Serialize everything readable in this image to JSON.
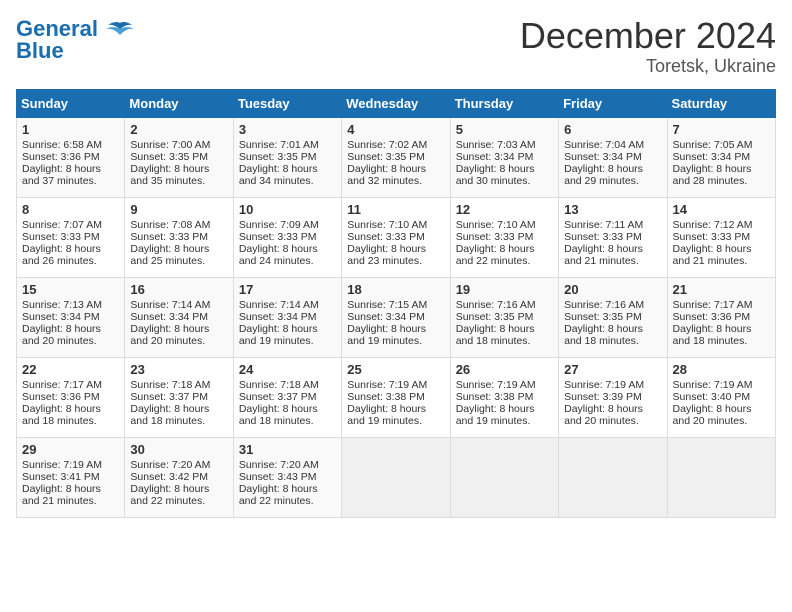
{
  "logo": {
    "text_general": "General",
    "text_blue": "Blue"
  },
  "title": "December 2024",
  "subtitle": "Toretsk, Ukraine",
  "days_header": [
    "Sunday",
    "Monday",
    "Tuesday",
    "Wednesday",
    "Thursday",
    "Friday",
    "Saturday"
  ],
  "weeks": [
    [
      {
        "day": "1",
        "sunrise": "Sunrise: 6:58 AM",
        "sunset": "Sunset: 3:36 PM",
        "daylight": "Daylight: 8 hours and 37 minutes."
      },
      {
        "day": "2",
        "sunrise": "Sunrise: 7:00 AM",
        "sunset": "Sunset: 3:35 PM",
        "daylight": "Daylight: 8 hours and 35 minutes."
      },
      {
        "day": "3",
        "sunrise": "Sunrise: 7:01 AM",
        "sunset": "Sunset: 3:35 PM",
        "daylight": "Daylight: 8 hours and 34 minutes."
      },
      {
        "day": "4",
        "sunrise": "Sunrise: 7:02 AM",
        "sunset": "Sunset: 3:35 PM",
        "daylight": "Daylight: 8 hours and 32 minutes."
      },
      {
        "day": "5",
        "sunrise": "Sunrise: 7:03 AM",
        "sunset": "Sunset: 3:34 PM",
        "daylight": "Daylight: 8 hours and 30 minutes."
      },
      {
        "day": "6",
        "sunrise": "Sunrise: 7:04 AM",
        "sunset": "Sunset: 3:34 PM",
        "daylight": "Daylight: 8 hours and 29 minutes."
      },
      {
        "day": "7",
        "sunrise": "Sunrise: 7:05 AM",
        "sunset": "Sunset: 3:34 PM",
        "daylight": "Daylight: 8 hours and 28 minutes."
      }
    ],
    [
      {
        "day": "8",
        "sunrise": "Sunrise: 7:07 AM",
        "sunset": "Sunset: 3:33 PM",
        "daylight": "Daylight: 8 hours and 26 minutes."
      },
      {
        "day": "9",
        "sunrise": "Sunrise: 7:08 AM",
        "sunset": "Sunset: 3:33 PM",
        "daylight": "Daylight: 8 hours and 25 minutes."
      },
      {
        "day": "10",
        "sunrise": "Sunrise: 7:09 AM",
        "sunset": "Sunset: 3:33 PM",
        "daylight": "Daylight: 8 hours and 24 minutes."
      },
      {
        "day": "11",
        "sunrise": "Sunrise: 7:10 AM",
        "sunset": "Sunset: 3:33 PM",
        "daylight": "Daylight: 8 hours and 23 minutes."
      },
      {
        "day": "12",
        "sunrise": "Sunrise: 7:10 AM",
        "sunset": "Sunset: 3:33 PM",
        "daylight": "Daylight: 8 hours and 22 minutes."
      },
      {
        "day": "13",
        "sunrise": "Sunrise: 7:11 AM",
        "sunset": "Sunset: 3:33 PM",
        "daylight": "Daylight: 8 hours and 21 minutes."
      },
      {
        "day": "14",
        "sunrise": "Sunrise: 7:12 AM",
        "sunset": "Sunset: 3:33 PM",
        "daylight": "Daylight: 8 hours and 21 minutes."
      }
    ],
    [
      {
        "day": "15",
        "sunrise": "Sunrise: 7:13 AM",
        "sunset": "Sunset: 3:34 PM",
        "daylight": "Daylight: 8 hours and 20 minutes."
      },
      {
        "day": "16",
        "sunrise": "Sunrise: 7:14 AM",
        "sunset": "Sunset: 3:34 PM",
        "daylight": "Daylight: 8 hours and 20 minutes."
      },
      {
        "day": "17",
        "sunrise": "Sunrise: 7:14 AM",
        "sunset": "Sunset: 3:34 PM",
        "daylight": "Daylight: 8 hours and 19 minutes."
      },
      {
        "day": "18",
        "sunrise": "Sunrise: 7:15 AM",
        "sunset": "Sunset: 3:34 PM",
        "daylight": "Daylight: 8 hours and 19 minutes."
      },
      {
        "day": "19",
        "sunrise": "Sunrise: 7:16 AM",
        "sunset": "Sunset: 3:35 PM",
        "daylight": "Daylight: 8 hours and 18 minutes."
      },
      {
        "day": "20",
        "sunrise": "Sunrise: 7:16 AM",
        "sunset": "Sunset: 3:35 PM",
        "daylight": "Daylight: 8 hours and 18 minutes."
      },
      {
        "day": "21",
        "sunrise": "Sunrise: 7:17 AM",
        "sunset": "Sunset: 3:36 PM",
        "daylight": "Daylight: 8 hours and 18 minutes."
      }
    ],
    [
      {
        "day": "22",
        "sunrise": "Sunrise: 7:17 AM",
        "sunset": "Sunset: 3:36 PM",
        "daylight": "Daylight: 8 hours and 18 minutes."
      },
      {
        "day": "23",
        "sunrise": "Sunrise: 7:18 AM",
        "sunset": "Sunset: 3:37 PM",
        "daylight": "Daylight: 8 hours and 18 minutes."
      },
      {
        "day": "24",
        "sunrise": "Sunrise: 7:18 AM",
        "sunset": "Sunset: 3:37 PM",
        "daylight": "Daylight: 8 hours and 18 minutes."
      },
      {
        "day": "25",
        "sunrise": "Sunrise: 7:19 AM",
        "sunset": "Sunset: 3:38 PM",
        "daylight": "Daylight: 8 hours and 19 minutes."
      },
      {
        "day": "26",
        "sunrise": "Sunrise: 7:19 AM",
        "sunset": "Sunset: 3:38 PM",
        "daylight": "Daylight: 8 hours and 19 minutes."
      },
      {
        "day": "27",
        "sunrise": "Sunrise: 7:19 AM",
        "sunset": "Sunset: 3:39 PM",
        "daylight": "Daylight: 8 hours and 20 minutes."
      },
      {
        "day": "28",
        "sunrise": "Sunrise: 7:19 AM",
        "sunset": "Sunset: 3:40 PM",
        "daylight": "Daylight: 8 hours and 20 minutes."
      }
    ],
    [
      {
        "day": "29",
        "sunrise": "Sunrise: 7:19 AM",
        "sunset": "Sunset: 3:41 PM",
        "daylight": "Daylight: 8 hours and 21 minutes."
      },
      {
        "day": "30",
        "sunrise": "Sunrise: 7:20 AM",
        "sunset": "Sunset: 3:42 PM",
        "daylight": "Daylight: 8 hours and 22 minutes."
      },
      {
        "day": "31",
        "sunrise": "Sunrise: 7:20 AM",
        "sunset": "Sunset: 3:43 PM",
        "daylight": "Daylight: 8 hours and 22 minutes."
      },
      null,
      null,
      null,
      null
    ]
  ]
}
